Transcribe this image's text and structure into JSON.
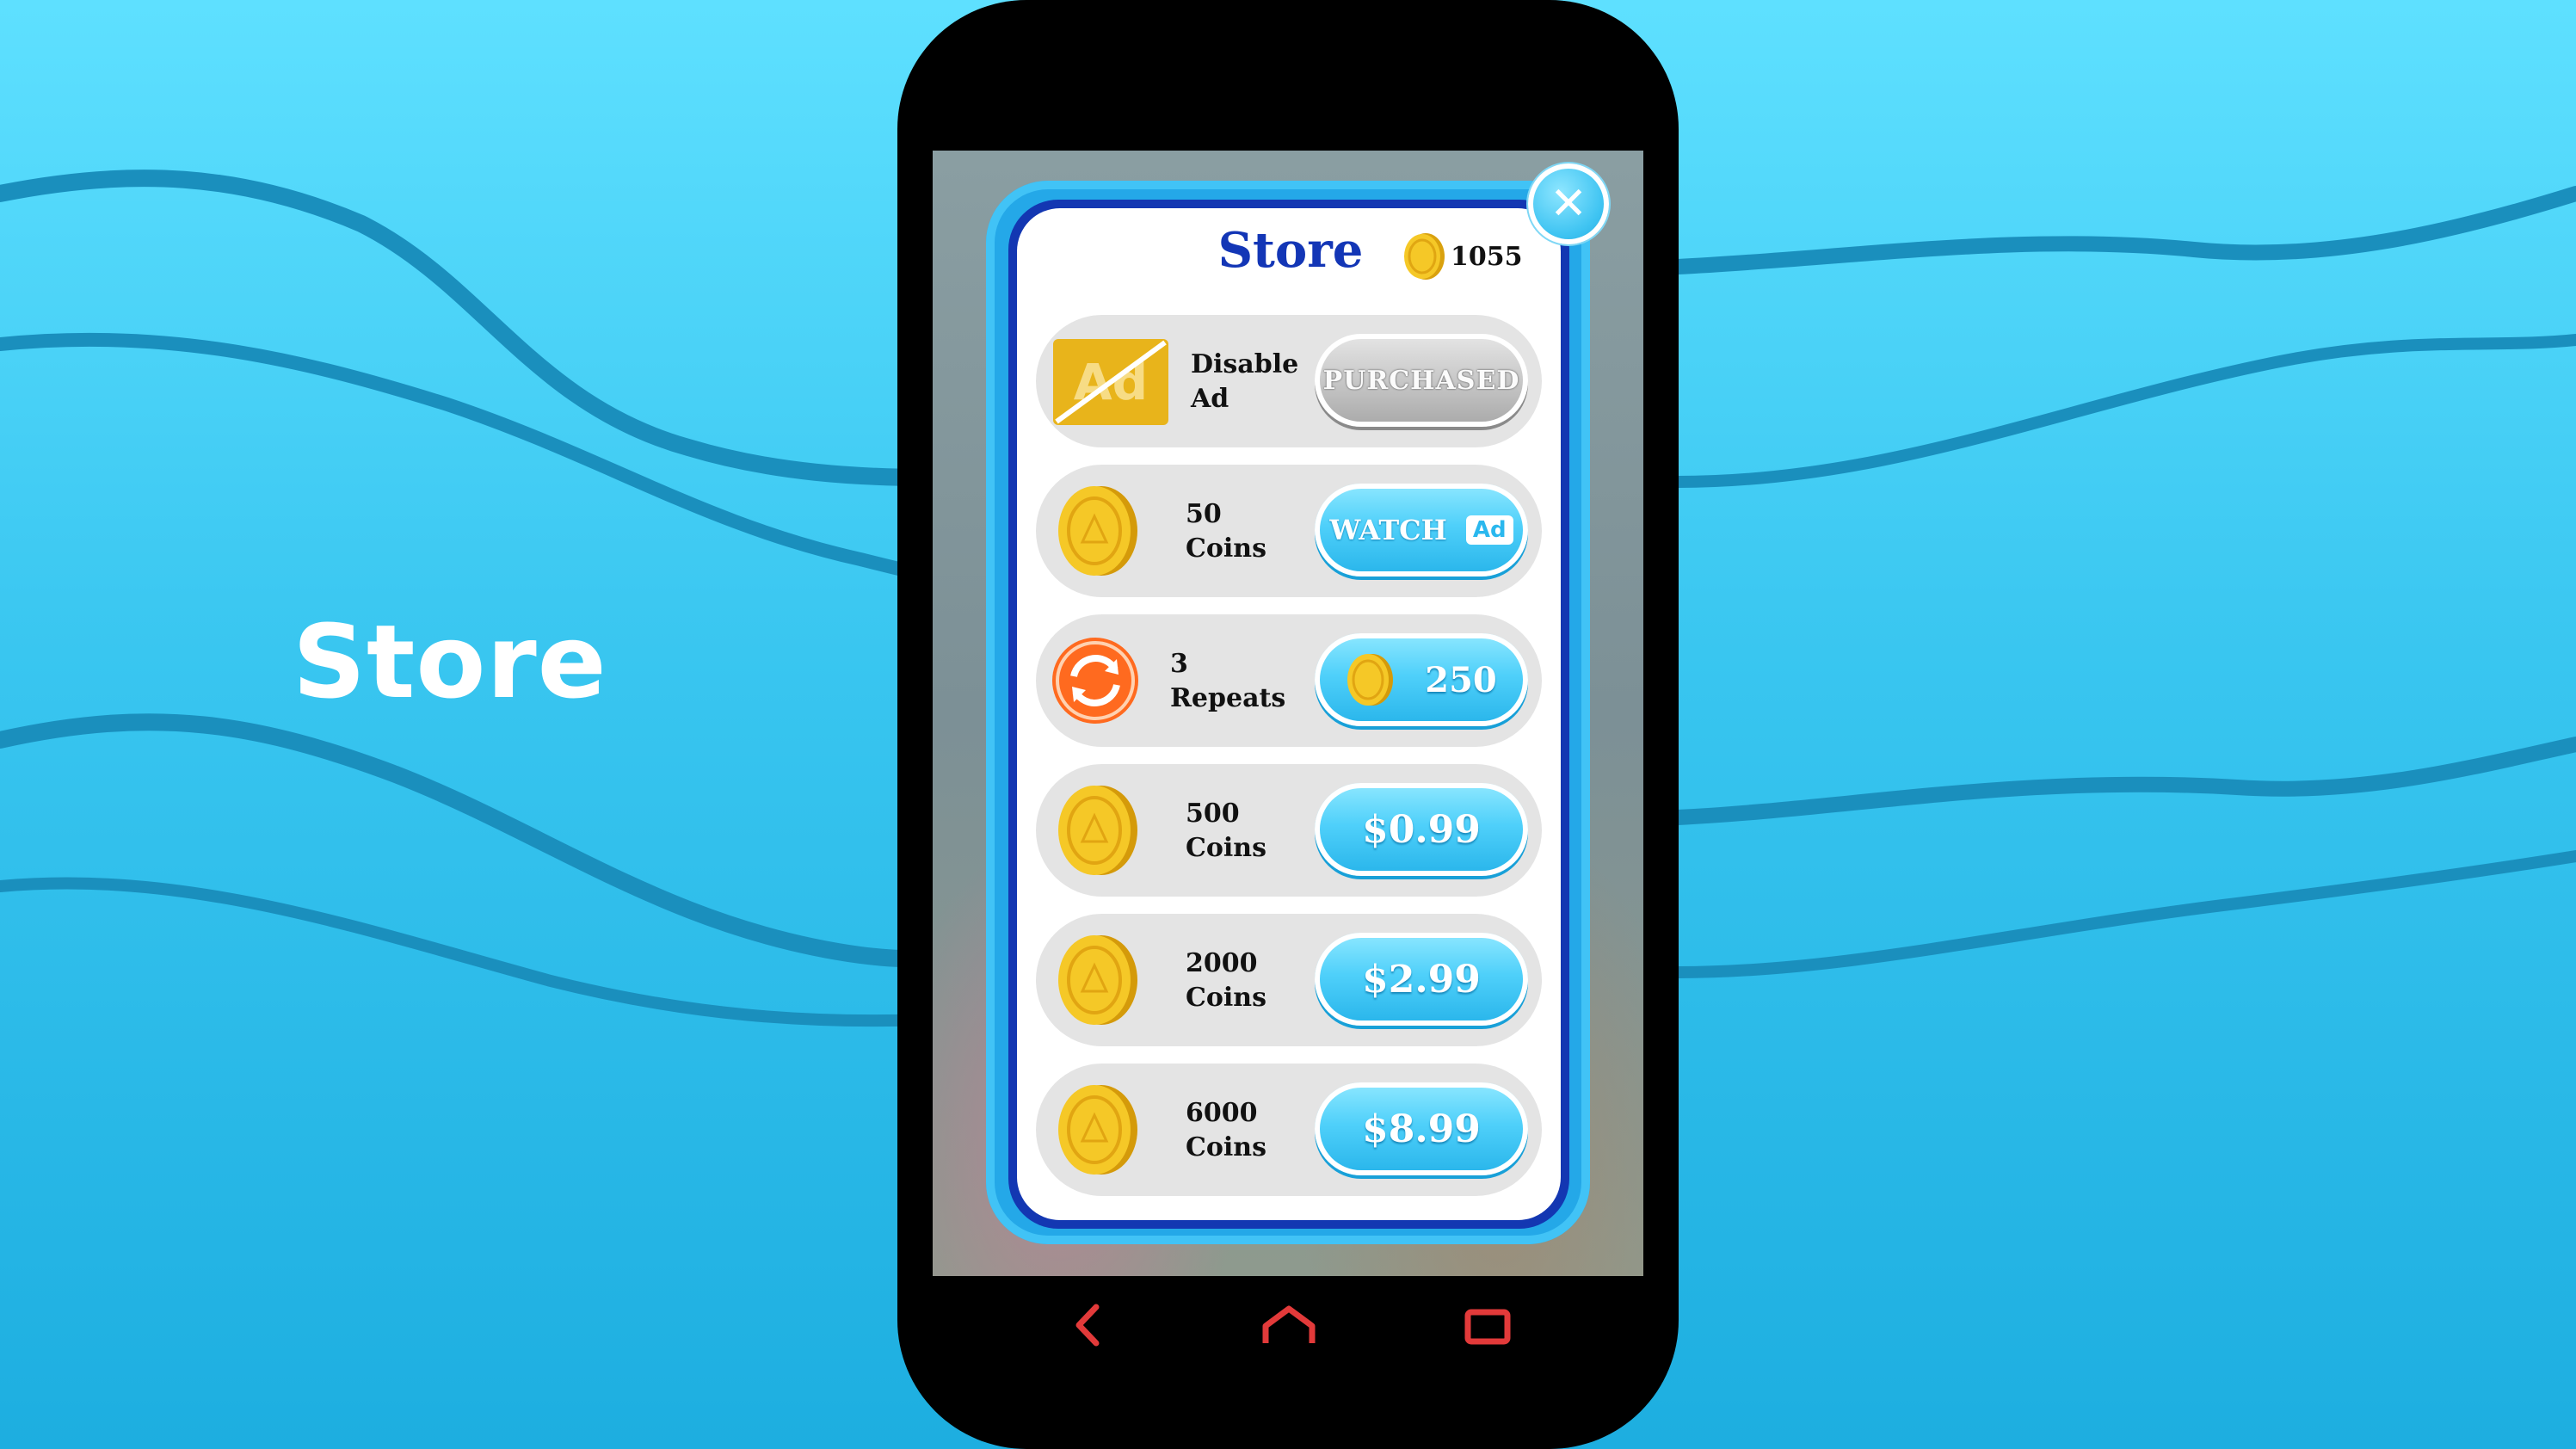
{
  "page": {
    "side_title": "Store"
  },
  "store": {
    "title": "Store",
    "coin_balance": "1055",
    "close_icon": "close-icon",
    "items": [
      {
        "icon": "ad-icon",
        "icon_text": "Ad",
        "label_line1": "Disable",
        "label_line2": "Ad",
        "button": "PURCHASED",
        "button_state": "disabled"
      },
      {
        "icon": "coin-icon",
        "label_line1": "50",
        "label_line2": "Coins",
        "button": "WATCH",
        "button_chip": "Ad"
      },
      {
        "icon": "repeat-icon",
        "label_line1": "3",
        "label_line2": "Repeats",
        "button": "250",
        "button_icon": "coin-icon"
      },
      {
        "icon": "coin-icon",
        "label_line1": "500",
        "label_line2": "Coins",
        "button": "$0.99"
      },
      {
        "icon": "coin-icon",
        "label_line1": "2000",
        "label_line2": "Coins",
        "button": "$2.99"
      },
      {
        "icon": "coin-icon",
        "label_line1": "6000",
        "label_line2": "Coins",
        "button": "$8.99"
      }
    ]
  },
  "navbar": {
    "back_icon": "back-icon",
    "home_icon": "home-icon",
    "recents_icon": "recents-icon"
  },
  "colors": {
    "accent": "#1336b6",
    "button_blue": "#3cc8f6",
    "coin_gold": "#f2c21a",
    "nav_icons": "#e23a3a"
  }
}
